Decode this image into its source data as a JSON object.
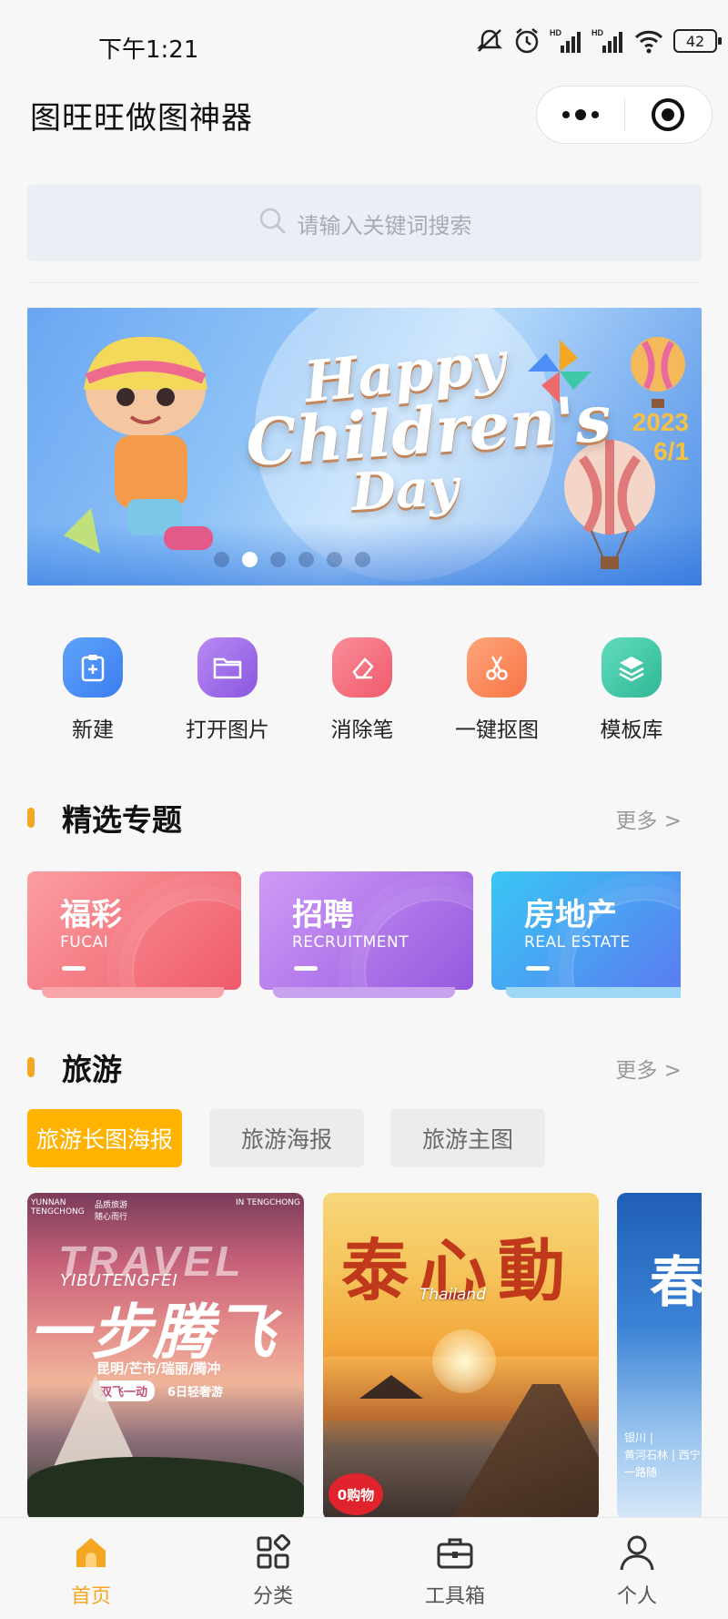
{
  "status_bar": {
    "time": "下午1:21",
    "battery": "42",
    "icons": [
      "mute-icon",
      "alarm-icon",
      "signal-hd-icon",
      "signal-hd-icon",
      "wifi-icon",
      "battery-icon"
    ],
    "signal_label": "HD"
  },
  "header": {
    "title": "图旺旺做图神器",
    "capsule": {
      "more_icon": "more-dots-icon",
      "close_icon": "record-circle-icon"
    }
  },
  "search": {
    "placeholder": "请输入关键词搜索",
    "icon": "search-icon"
  },
  "banner": {
    "line1": "Happy",
    "line2": "Children's",
    "line3": "Day",
    "year": "2023",
    "date": "6/1",
    "dot_count": 6,
    "active_dot": 1
  },
  "tools": [
    {
      "label": "新建",
      "icon": "new-clipboard-icon",
      "color": "#4c8df6"
    },
    {
      "label": "打开图片",
      "icon": "open-folder-icon",
      "color": "#9f6be8"
    },
    {
      "label": "消除笔",
      "icon": "eraser-icon",
      "color": "#f36f7f"
    },
    {
      "label": "一键抠图",
      "icon": "scissors-icon",
      "color": "#fb8a57"
    },
    {
      "label": "模板库",
      "icon": "layers-icon",
      "color": "#3dc9a8"
    }
  ],
  "featured": {
    "title": "精选专题",
    "more": "更多 >",
    "topics": [
      {
        "cn": "福彩",
        "en": "FUCAI",
        "color_from": "#fb8a8e",
        "color_to": "#ef5a6b"
      },
      {
        "cn": "招聘",
        "en": "RECRUITMENT",
        "color_from": "#c58af5",
        "color_to": "#9459de"
      },
      {
        "cn": "房地产",
        "en": "REAL ESTATE",
        "color_from": "#39c7f5",
        "color_to": "#5a7cf0"
      }
    ]
  },
  "travel": {
    "title": "旅游",
    "more": "更多 >",
    "tabs": [
      "旅游长图海报",
      "旅游海报",
      "旅游主图"
    ],
    "active_tab": 0,
    "posters": [
      {
        "corner_left": "YUNNAN\nTENGCHONG",
        "corner_mid": "品质旅游\n随心而行",
        "corner_right": "IN TENGCHONG",
        "big_en": "TRAVEL",
        "sub_en": "YIBUTENGFEI",
        "big_cn": "一步腾飞",
        "route": "昆明/芒市/瑞丽/腾冲",
        "tag1": "双飞一动",
        "tag2": "6日轻奢游"
      },
      {
        "big_cn": "泰心動",
        "en": "Thailand",
        "badge": "0购物"
      },
      {
        "big_cn": "春",
        "small": "银川 |\n黄河石林 | 西宁 | 青\n一路随"
      }
    ]
  },
  "tabbar": [
    {
      "label": "首页",
      "icon": "home-icon",
      "active": true
    },
    {
      "label": "分类",
      "icon": "category-grid-icon",
      "active": false
    },
    {
      "label": "工具箱",
      "icon": "toolbox-icon",
      "active": false
    },
    {
      "label": "个人",
      "icon": "user-icon",
      "active": false
    }
  ],
  "colors": {
    "accent": "#f5a623",
    "search_bg": "#eceef6"
  }
}
